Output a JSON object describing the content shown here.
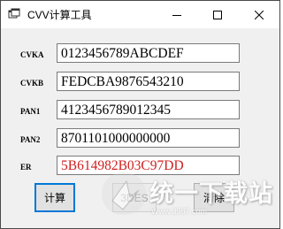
{
  "window": {
    "title": "CVV计算工具",
    "icons": {
      "app": "app-window-icon",
      "minimize": "minimize-icon",
      "maximize": "maximize-icon",
      "close": "close-icon"
    }
  },
  "fields": [
    {
      "label": "CVKA",
      "value": "0123456789ABCDEF"
    },
    {
      "label": "CVKB",
      "value": "FEDCBA9876543210"
    },
    {
      "label": "PAN1",
      "value": "4123456789012345"
    },
    {
      "label": "PAN2",
      "value": "8701101000000000"
    },
    {
      "label": "ER",
      "value": "5B614982B03C97DD",
      "color": "#d01f1f"
    }
  ],
  "buttons": {
    "calc": "计算",
    "des": "3DES",
    "clear": "清除"
  },
  "watermark": {
    "title": "统一下载站",
    "subtitle": "Www.3987.com"
  }
}
